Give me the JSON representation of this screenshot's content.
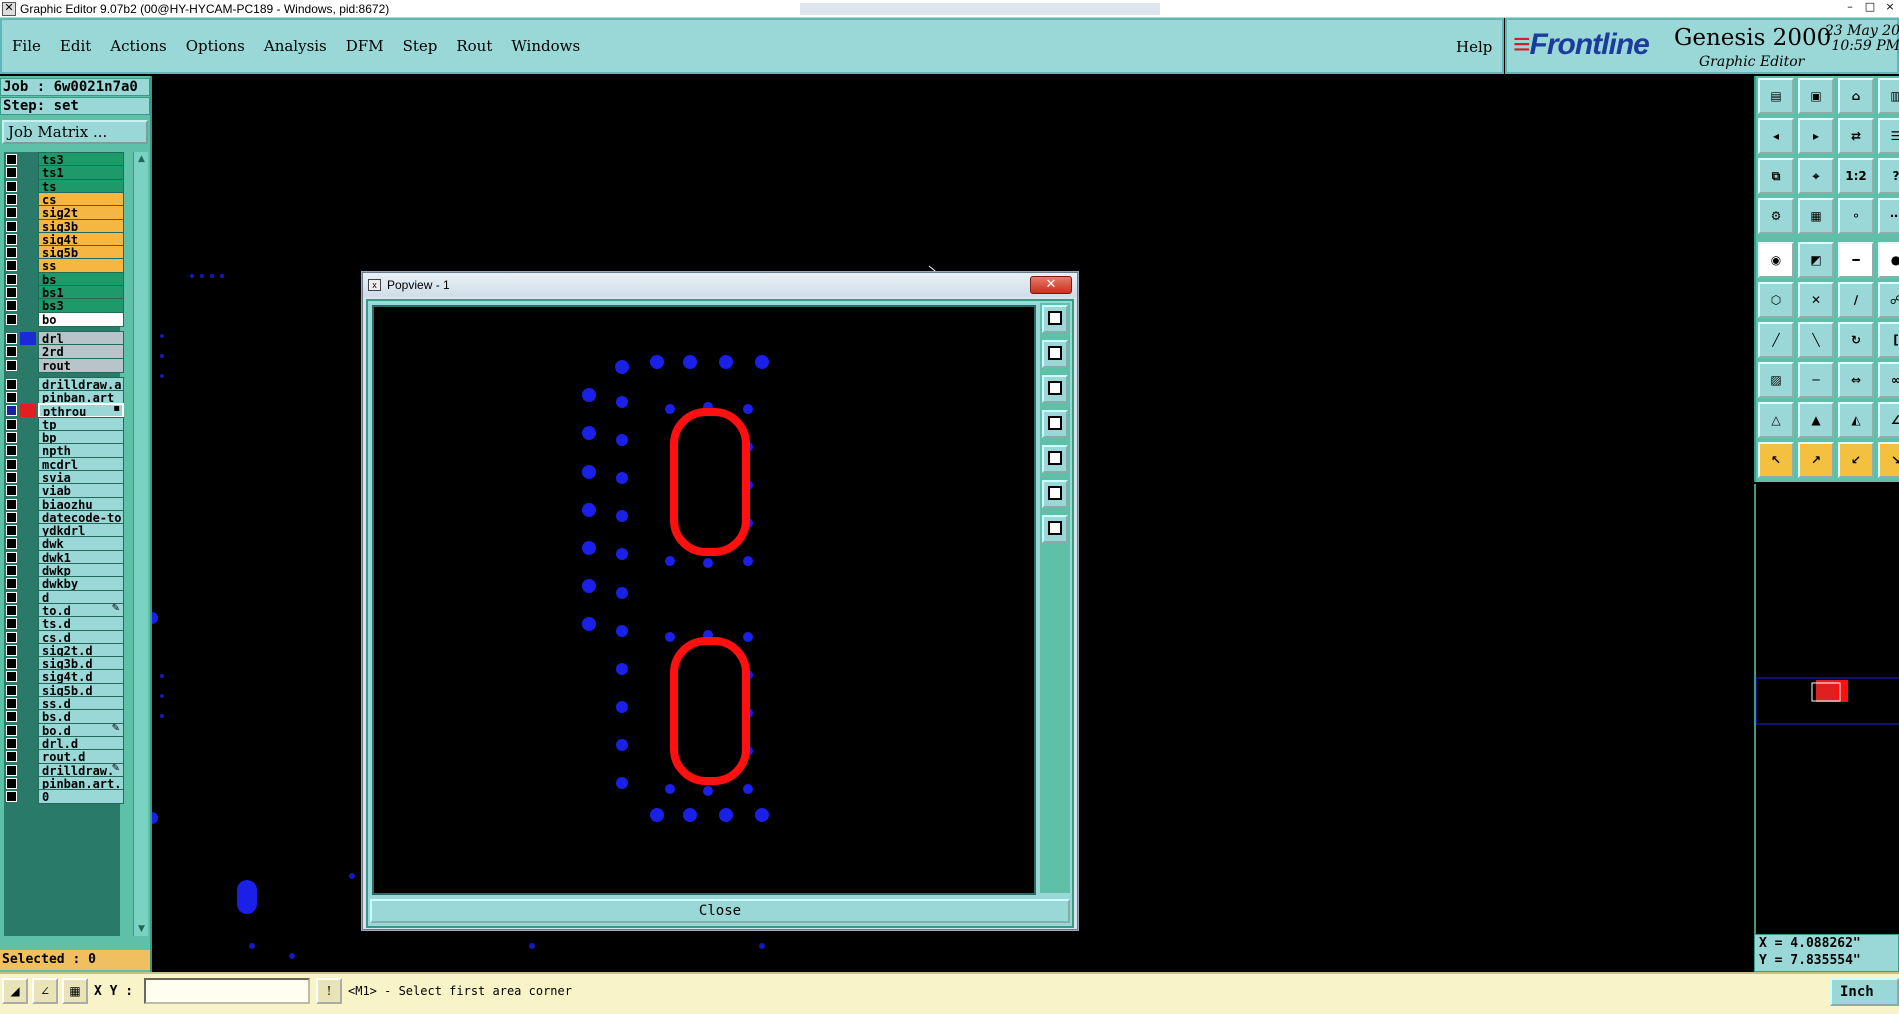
{
  "window": {
    "title": "Graphic Editor 9.07b2 (00@HY-HYCAM-PC189 - Windows, pid:8672)",
    "controls": [
      "–",
      "□",
      "×"
    ]
  },
  "menu": {
    "items": [
      "File",
      "Edit",
      "Actions",
      "Options",
      "Analysis",
      "DFM",
      "Step",
      "Rout",
      "Windows"
    ],
    "help": "Help"
  },
  "brand": {
    "logo": "Frontline",
    "product": "Genesis 2000",
    "subtitle": "Graphic Editor",
    "date": "23 May 20",
    "time": "10:59 PM"
  },
  "job": {
    "job_line": "Job : 6w0021n7a0",
    "step_line": "Step: set",
    "matrix_button": "Job Matrix ..."
  },
  "layers": [
    {
      "name": "ts3",
      "color": "#1e9a6a",
      "swatch": ""
    },
    {
      "name": "ts1",
      "color": "#1e9a6a",
      "swatch": ""
    },
    {
      "name": "ts",
      "color": "#1e9a6a",
      "swatch": ""
    },
    {
      "name": "cs",
      "color": "#f5b642",
      "swatch": ""
    },
    {
      "name": "sig2t",
      "color": "#f5b642",
      "swatch": ""
    },
    {
      "name": "sig3b",
      "color": "#f5b642",
      "swatch": ""
    },
    {
      "name": "sig4t",
      "color": "#f5b642",
      "swatch": ""
    },
    {
      "name": "sig5b",
      "color": "#f5b642",
      "swatch": ""
    },
    {
      "name": "ss",
      "color": "#f5b642",
      "swatch": ""
    },
    {
      "name": "bs",
      "color": "#1e9a6a",
      "swatch": ""
    },
    {
      "name": "bs1",
      "color": "#1e9a6a",
      "swatch": ""
    },
    {
      "name": "bs3",
      "color": "#1e9a6a",
      "swatch": ""
    },
    {
      "name": "bo",
      "color": "#ffffff",
      "swatch": ""
    },
    {
      "name": "drl",
      "color": "#b8c4c8",
      "swatch": "#1a2ad8"
    },
    {
      "name": "2rd",
      "color": "#b8c4c8",
      "swatch": ""
    },
    {
      "name": "rout",
      "color": "#b8c4c8",
      "swatch": ""
    },
    {
      "name": "drilldraw.a",
      "color": "#9ad8d8",
      "swatch": ""
    },
    {
      "name": "pinban.art",
      "color": "#9ad8d8",
      "swatch": ""
    },
    {
      "name": "pthrou",
      "color": "#9ad8d8",
      "swatch": "#e0201e",
      "selected": true,
      "icon": "▪"
    },
    {
      "name": "tp",
      "color": "#9ad8d8",
      "swatch": ""
    },
    {
      "name": "bp",
      "color": "#9ad8d8",
      "swatch": ""
    },
    {
      "name": "npth",
      "color": "#9ad8d8",
      "swatch": ""
    },
    {
      "name": "mcdrl",
      "color": "#9ad8d8",
      "swatch": ""
    },
    {
      "name": "svia",
      "color": "#9ad8d8",
      "swatch": ""
    },
    {
      "name": "viab",
      "color": "#9ad8d8",
      "swatch": ""
    },
    {
      "name": "biaozhu",
      "color": "#9ad8d8",
      "swatch": ""
    },
    {
      "name": "datecode-to",
      "color": "#9ad8d8",
      "swatch": ""
    },
    {
      "name": "ydkdrl",
      "color": "#9ad8d8",
      "swatch": ""
    },
    {
      "name": "dwk",
      "color": "#9ad8d8",
      "swatch": ""
    },
    {
      "name": "dwk1",
      "color": "#9ad8d8",
      "swatch": ""
    },
    {
      "name": "dwkp",
      "color": "#9ad8d8",
      "swatch": ""
    },
    {
      "name": "dwkby",
      "color": "#9ad8d8",
      "swatch": ""
    },
    {
      "name": "d",
      "color": "#9ad8d8",
      "swatch": ""
    },
    {
      "name": "to.d",
      "color": "#9ad8d8",
      "swatch": "",
      "icon": "✎"
    },
    {
      "name": "ts.d",
      "color": "#9ad8d8",
      "swatch": ""
    },
    {
      "name": "cs.d",
      "color": "#9ad8d8",
      "swatch": ""
    },
    {
      "name": "sig2t.d",
      "color": "#9ad8d8",
      "swatch": ""
    },
    {
      "name": "sig3b.d",
      "color": "#9ad8d8",
      "swatch": ""
    },
    {
      "name": "sig4t.d",
      "color": "#9ad8d8",
      "swatch": ""
    },
    {
      "name": "sig5b.d",
      "color": "#9ad8d8",
      "swatch": ""
    },
    {
      "name": "ss.d",
      "color": "#9ad8d8",
      "swatch": ""
    },
    {
      "name": "bs.d",
      "color": "#9ad8d8",
      "swatch": ""
    },
    {
      "name": "bo.d",
      "color": "#9ad8d8",
      "swatch": "",
      "icon": "✎"
    },
    {
      "name": "drl.d",
      "color": "#9ad8d8",
      "swatch": ""
    },
    {
      "name": "rout.d",
      "color": "#9ad8d8",
      "swatch": ""
    },
    {
      "name": "drilldraw.",
      "color": "#9ad8d8",
      "swatch": "",
      "icon": "✎"
    },
    {
      "name": "pinban.art.",
      "color": "#9ad8d8",
      "swatch": ""
    },
    {
      "name": "0",
      "color": "#9ad8d8",
      "swatch": ""
    }
  ],
  "selected_count": "Selected : 0",
  "popview": {
    "title": "Popview - 1",
    "close_label": "Close",
    "close_x": "✕"
  },
  "right_tools": [
    {
      "icon": "open-job-icon",
      "glyph": "▤",
      "style": ""
    },
    {
      "icon": "save-icon",
      "glyph": "▣",
      "style": ""
    },
    {
      "icon": "home-icon",
      "glyph": "⌂",
      "style": ""
    },
    {
      "icon": "panel-icon",
      "glyph": "▥",
      "style": ""
    },
    {
      "icon": "prev-step-icon",
      "glyph": "◂",
      "style": ""
    },
    {
      "icon": "next-step-icon",
      "glyph": "▸",
      "style": ""
    },
    {
      "icon": "flip-icon",
      "glyph": "⇄",
      "style": ""
    },
    {
      "icon": "list-icon",
      "glyph": "☰",
      "style": ""
    },
    {
      "icon": "zoom-fit-icon",
      "glyph": "⧉",
      "style": ""
    },
    {
      "icon": "zoom-home-icon",
      "glyph": "⌖",
      "style": ""
    },
    {
      "icon": "ratio-icon",
      "glyph": "1:2",
      "style": ""
    },
    {
      "icon": "help-icon",
      "glyph": "?",
      "style": ""
    },
    {
      "icon": "settings-icon",
      "glyph": "⚙",
      "style": ""
    },
    {
      "icon": "grid-icon",
      "glyph": "▦",
      "style": ""
    },
    {
      "icon": "snap-icon",
      "glyph": "⚬",
      "style": ""
    },
    {
      "icon": "align-icon",
      "glyph": "⋯",
      "style": ""
    },
    {
      "icon": "pad-icon",
      "glyph": "◉",
      "style": "w"
    },
    {
      "icon": "measure-icon",
      "glyph": "◩",
      "style": ""
    },
    {
      "icon": "ruler-icon",
      "glyph": "━",
      "style": "w"
    },
    {
      "icon": "dot-icon",
      "glyph": "●",
      "style": "w"
    },
    {
      "icon": "connect-icon",
      "glyph": "⬡",
      "style": ""
    },
    {
      "icon": "cross-icon",
      "glyph": "✕",
      "style": ""
    },
    {
      "icon": "line-snap-icon",
      "glyph": "∕",
      "style": ""
    },
    {
      "icon": "arc-snap-icon",
      "glyph": "☍",
      "style": ""
    },
    {
      "icon": "draw-line-icon",
      "glyph": "╱",
      "style": ""
    },
    {
      "icon": "draw-line2-icon",
      "glyph": "╲",
      "style": ""
    },
    {
      "icon": "rotate-icon",
      "glyph": "↻",
      "style": ""
    },
    {
      "icon": "bracket-icon",
      "glyph": "[",
      "style": ""
    },
    {
      "icon": "square-select-icon",
      "glyph": "▨",
      "style": ""
    },
    {
      "icon": "segment-icon",
      "glyph": "─",
      "style": ""
    },
    {
      "icon": "dimension-icon",
      "glyph": "⇔",
      "style": ""
    },
    {
      "icon": "link-icon",
      "glyph": "∞",
      "style": ""
    },
    {
      "icon": "triangle-icon",
      "glyph": "△",
      "style": ""
    },
    {
      "icon": "triangle2-icon",
      "glyph": "▲",
      "style": ""
    },
    {
      "icon": "triangle3-icon",
      "glyph": "◭",
      "style": ""
    },
    {
      "icon": "angle-icon",
      "glyph": "∠",
      "style": ""
    },
    {
      "icon": "pointer-icon",
      "glyph": "↖",
      "style": "y"
    },
    {
      "icon": "pointer-select-icon",
      "glyph": "↗",
      "style": "y"
    },
    {
      "icon": "pointer-area-icon",
      "glyph": "↙",
      "style": "y"
    },
    {
      "icon": "pointer-step-icon",
      "glyph": "↘",
      "style": "y"
    }
  ],
  "coords": {
    "x": "X = 4.088262\"",
    "y": "Y = 7.835554\""
  },
  "status": {
    "xy_label": "X Y :",
    "xy_value": "",
    "prompt": "<M1> - Select first area corner",
    "units": "Inch"
  }
}
